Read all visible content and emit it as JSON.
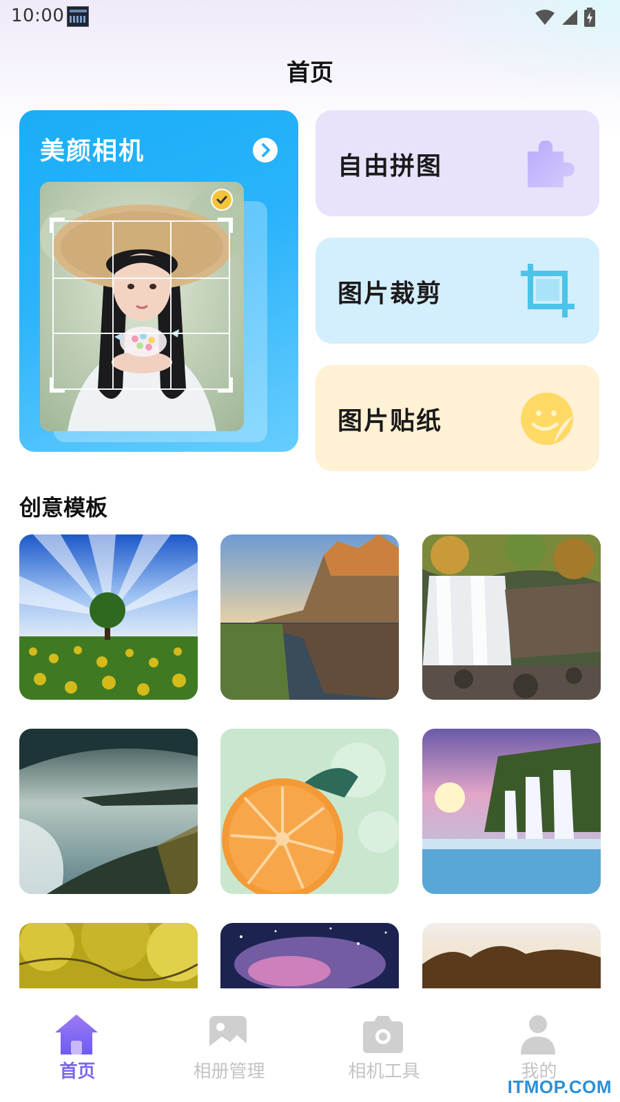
{
  "status_bar": {
    "time": "10:00"
  },
  "header": {
    "title": "首页"
  },
  "camera_card": {
    "title": "美颜相机"
  },
  "features": [
    {
      "label": "自由拼图",
      "icon": "puzzle-icon"
    },
    {
      "label": "图片裁剪",
      "icon": "crop-icon"
    },
    {
      "label": "图片贴纸",
      "icon": "sticker-face-icon"
    }
  ],
  "templates": {
    "title": "创意模板",
    "items": [
      {
        "scene": "tree-sunflower-field"
      },
      {
        "scene": "cliff-lake-reflection"
      },
      {
        "scene": "waterfall-rocks"
      },
      {
        "scene": "stormy-coast"
      },
      {
        "scene": "orange-slice-turtle"
      },
      {
        "scene": "sunset-waterfall"
      },
      {
        "scene": "yellow-autumn-leaves"
      },
      {
        "scene": "nebula"
      },
      {
        "scene": "savanna-sunrise"
      }
    ]
  },
  "tab_bar": {
    "tabs": [
      {
        "label": "首页",
        "icon": "home-icon",
        "active": true
      },
      {
        "label": "相册管理",
        "icon": "album-icon",
        "active": false
      },
      {
        "label": "相机工具",
        "icon": "camera-icon",
        "active": false
      },
      {
        "label": "我的",
        "icon": "profile-icon",
        "active": false
      }
    ]
  },
  "watermark": "ITMOP.COM",
  "colors": {
    "accent": "#7a66ee",
    "camera_card": "#2bb3fb",
    "collage_card": "#e8e2fb",
    "crop_card": "#d3eefc",
    "sticker_card": "#fff1d4"
  }
}
